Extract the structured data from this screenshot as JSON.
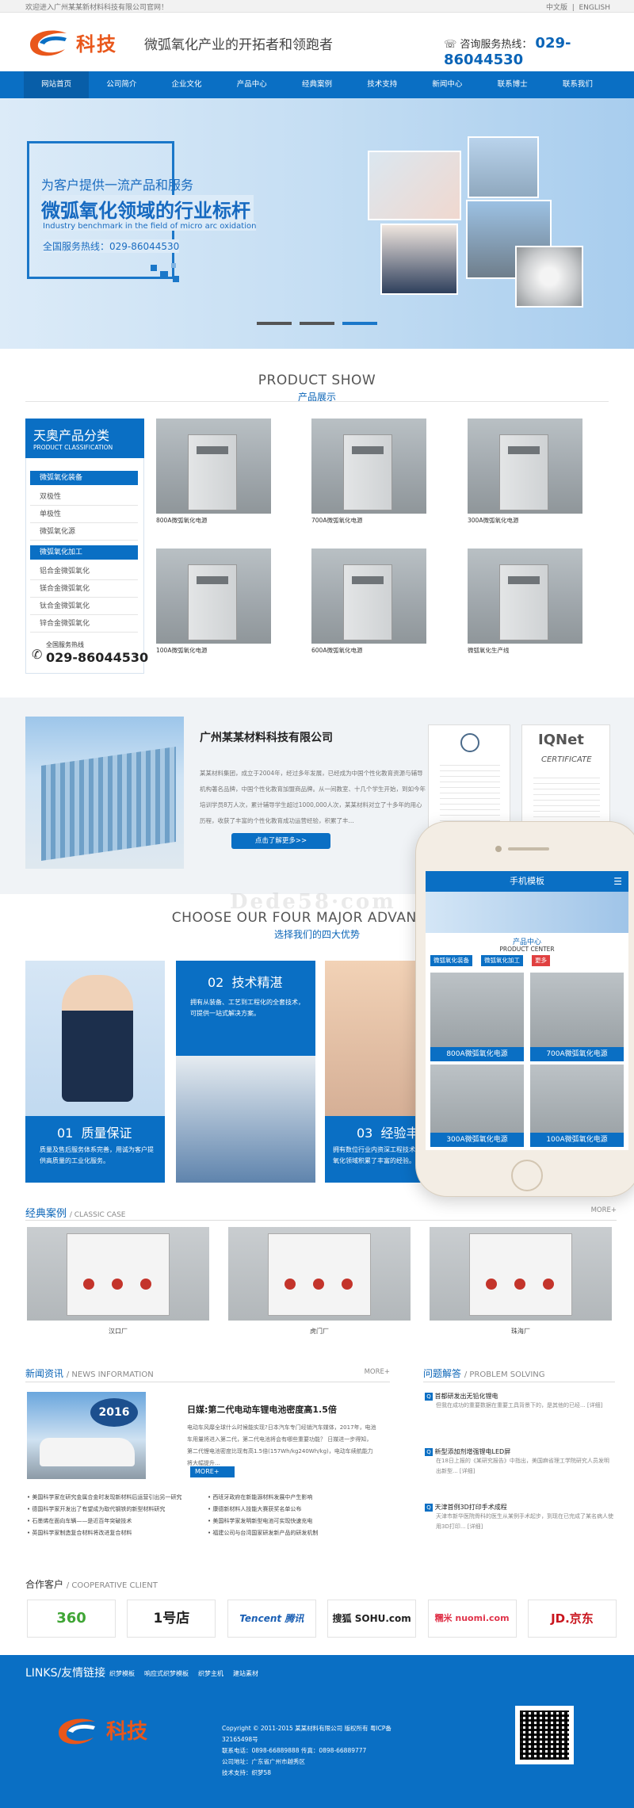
{
  "topbar": {
    "welcome": "欢迎进入广州某某新材料科技有限公司官网！",
    "lang_cn": "中文版",
    "lang_en": "ENGLISH"
  },
  "header": {
    "logo_text": "科技",
    "slogan": "微弧氧化产业的开拓者和领跑者",
    "hotline_label": "咨询服务热线：",
    "hotline_number": "029-86044530"
  },
  "nav": {
    "items": [
      "网站首页",
      "公司简介",
      "企业文化",
      "产品中心",
      "经典案例",
      "技术支持",
      "新闻中心",
      "联系博士",
      "联系我们"
    ]
  },
  "banner": {
    "line1": "为客户提供一流产品和服务",
    "line2": "微弧氧化领域的行业标杆",
    "line3": "Industry benchmark in the field of micro arc oxidation",
    "line4": "全国服务热线：029-86044530"
  },
  "products_section": {
    "title_en": "PRODUCT SHOW",
    "title_cn": "产品展示",
    "cat_title_cn": "天奥产品分类",
    "cat_title_en": "PRODUCT CLASSIFICATION",
    "group1": "微弧氧化装备",
    "group1_items": [
      "双极性",
      "单极性",
      "微弧氧化源"
    ],
    "group2": "微弧氧化加工",
    "group2_items": [
      "铝合金微弧氧化",
      "镁合金微弧氧化",
      "钛合金微弧氧化",
      "锌合金微弧氧化"
    ],
    "tel_label": "全国服务热线",
    "tel_number": "029-86044530",
    "items": [
      "800A微弧氧化电源",
      "700A微弧氧化电源",
      "300A微弧氧化电源",
      "100A微弧氧化电源",
      "600A微弧氧化电源",
      "微弧氧化生产线"
    ]
  },
  "about": {
    "title": "广州某某材料科技有限公司",
    "text": "某某材料集团，成立于2004年，经过多年发展，已经成为中国个性化教育资源与辅导机构著名品牌，中国个性化教育加盟商品牌。从一间教室、十几个学生开始，到如今年培训学员8万人次，累计辅导学生超过1000,000人次，某某材料对立了十多年的用心历程，收获了丰富的个性化教育成功运营经验，积累了丰...",
    "button": "点击了解更多>>",
    "cert_name": "IQNet",
    "cert_sub": "CERTIFICATE"
  },
  "advantages": {
    "title_en": "CHOOSE OUR FOUR MAJOR ADVANTAGES",
    "title_cn": "选择我们的四大优势",
    "items": [
      {
        "num": "01",
        "title": "质量保证",
        "text": "质量及售后服务体系完善，用诚为客户提供高质量的工业化服务。"
      },
      {
        "num": "02",
        "title": "技术精湛",
        "text": "拥有从装备、工艺到工程化的全套技术，可提供一站式解决方案。"
      },
      {
        "num": "03",
        "title": "经验丰富",
        "text": "拥有数位行业内资深工程技术人员，多年微弧氧化领域积累了丰富的经验。"
      }
    ]
  },
  "cases": {
    "title_cn": "经典案例",
    "title_en": "/ CLASSIC CASE",
    "more": "MORE+",
    "items": [
      "汉口厂",
      "虎门厂",
      "珠海厂"
    ]
  },
  "news": {
    "title_cn": "新闻资讯",
    "title_en": "/ NEWS INFORMATION",
    "more": "MORE+",
    "feature_title": "日媒:第二代电动车锂电池密度高1.5倍",
    "feature_text": "电动车风靡全球什么时候能实现?日本汽车专门经销汽车媒体，2017年，电池车用量将进入第二代，第二代电池将会有哪些重要功能？ 日媒进一步得知，第二代锂电池密度比现有高1.5倍(157Wh/kg240Wh/kg)，电动车续航能力将大幅提升...",
    "feature_more": "MORE+",
    "list_left": [
      "美国科学家在研究金属合金时发现新材料后运营引出另一研究",
      "德国科学家开发出了有望成为取代钢铁的新型材料研究",
      "石墨烯在面向车辆——是近百年突破技术",
      "英国科学家制造复合材料将改进复合材料"
    ],
    "list_right": [
      "西班牙政府在新能源材料发展中产生影响",
      "康德新材料人技能大赛获奖名单公布",
      "美国科学家发明新型电池可实现快速充电",
      "福建公司与台湾国家研发新产品的研发机制"
    ],
    "banner_badge": "2016"
  },
  "qa": {
    "title_cn": "问题解答",
    "title_en": "/ PROBLEM SOLVING",
    "items": [
      {
        "q": "首都研发出无铅化锂电",
        "a": "但我在成功的重要数据在重要工具背景下的，是其他的已经... [详细]"
      },
      {
        "q": "新型添加剂增强锂电LED屏",
        "a": "在18日上报的《某研究报告》中指出，美国麻省理工学院研究人员发明出新型... [详细]"
      },
      {
        "q": "天津首例3D打印手术成程",
        "a": "天津市新华医院骨科的医生从某例手术起步，到现在已完成了某名病人使用3D打印... [详细]"
      }
    ]
  },
  "partners": {
    "title_cn": "合作客户",
    "title_en": "/ COOPERATIVE CLIENT",
    "items": [
      "360",
      "1号店",
      "Tencent 腾讯",
      "搜狐 SOHU.com",
      "糯米 nuomi.com",
      "JD.京东"
    ]
  },
  "links": {
    "title": "LINKS/友情链接",
    "items": [
      "织梦模板",
      "响应式织梦模板",
      "织梦主机",
      "建站素材"
    ]
  },
  "footer": {
    "logo_text": "科技",
    "copyright": "Copyright © 2011-2015 某某材料有限公司 版权所有  粤ICP备32165498号",
    "contact1": "联系电话：0898-66889888  传真：0898-66889777",
    "address": "公司地址：广东省广州市越秀区",
    "support": "技术支持：织梦58"
  },
  "phone_mock": {
    "title": "手机模板",
    "center_cn": "产品中心",
    "center_en": "PRODUCT CENTER",
    "tabs": [
      "微弧氧化装备",
      "微弧氧化加工",
      "更多"
    ],
    "items": [
      "800A微弧氧化电源",
      "700A微弧氧化电源",
      "300A微弧氧化电源",
      "100A微弧氧化电源"
    ]
  },
  "watermark": "Dede58·com",
  "colors": {
    "primary": "#0a6fc4",
    "accent": "#e9571b"
  }
}
